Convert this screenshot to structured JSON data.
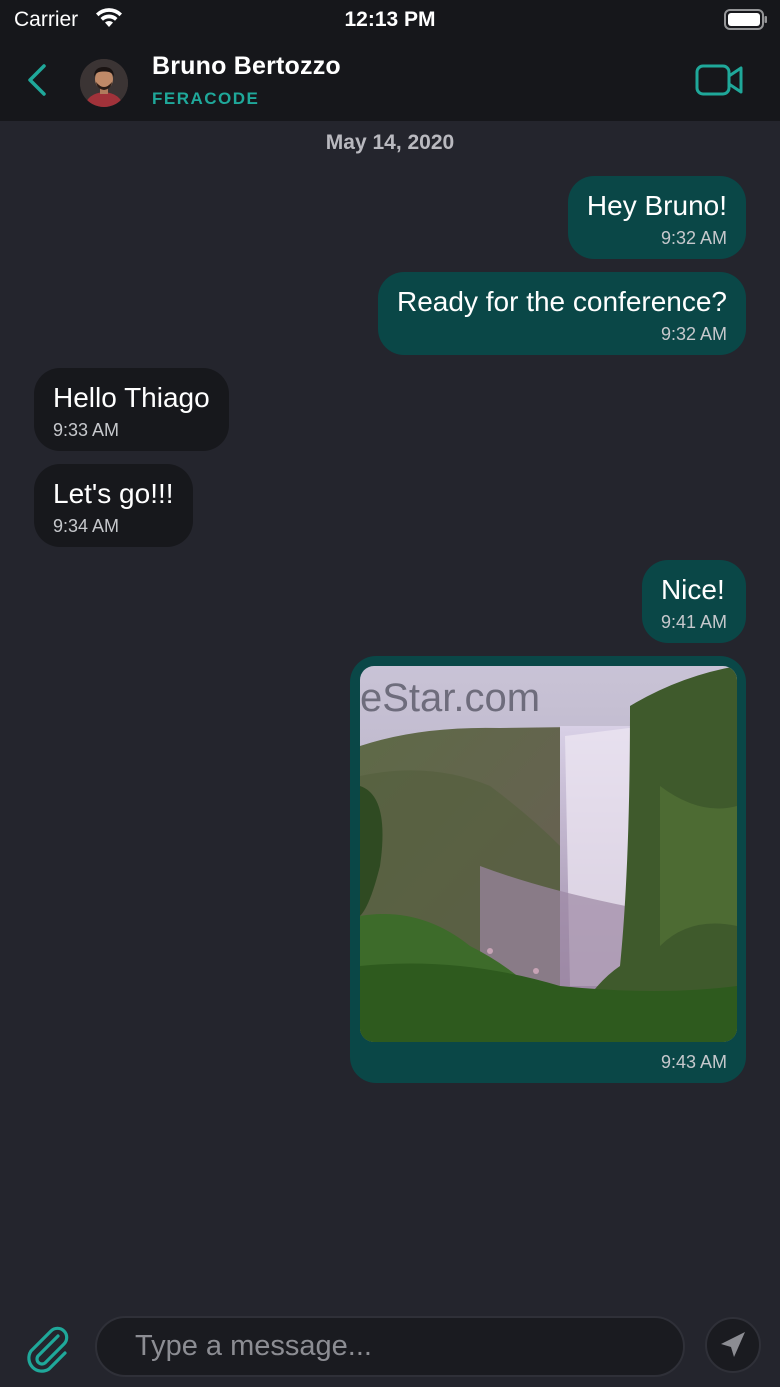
{
  "status_bar": {
    "carrier": "Carrier",
    "time": "12:13 PM"
  },
  "header": {
    "back_icon": "chevron-left-icon",
    "contact_name": "Bruno Bertozzo",
    "contact_subtitle": "FERACODE",
    "video_icon": "video-camera-icon"
  },
  "conversation": {
    "date": "May 14, 2020",
    "messages": [
      {
        "direction": "out",
        "text": "Hey Bruno!",
        "time": "9:32 AM"
      },
      {
        "direction": "out",
        "text": "Ready for the conference?",
        "time": "9:32 AM"
      },
      {
        "direction": "in",
        "text": "Hello Thiago",
        "time": "9:33 AM"
      },
      {
        "direction": "in",
        "text": "Let's go!!!",
        "time": "9:34 AM"
      },
      {
        "direction": "out",
        "text": "Nice!",
        "time": "9:41 AM"
      },
      {
        "direction": "out",
        "type": "image",
        "image": "waterfall-photo",
        "time": "9:43 AM"
      }
    ],
    "watermark": "eStar.com"
  },
  "composer": {
    "placeholder": "Type a message...",
    "attach_icon": "paperclip-icon",
    "send_icon": "send-arrow-icon"
  },
  "colors": {
    "accent": "#1fa89a",
    "outgoing_bubble": "#0a4747",
    "incoming_bubble": "#17181c",
    "background": "#24252d"
  }
}
